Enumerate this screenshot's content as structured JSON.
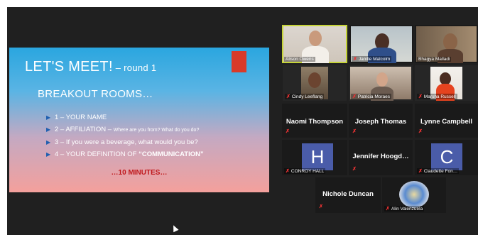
{
  "slide": {
    "title": "LET'S MEET!",
    "title_sub": " – round 1",
    "heading": "BREAKOUT ROOMS…",
    "items": [
      {
        "num": "1 – ",
        "text": "YOUR NAME",
        "small": "",
        "bold": ""
      },
      {
        "num": "2 – ",
        "text": "AFFILIATION – ",
        "small": "Where are you from?  What do you do?",
        "bold": ""
      },
      {
        "num": "3 – ",
        "text": "If you were a beverage, what would you be?",
        "small": "",
        "bold": ""
      },
      {
        "num": "4 – ",
        "text": "YOUR DEFINITION OF ",
        "small": "",
        "bold": "“COMMUNICATION”"
      }
    ],
    "timer": "…10 MINUTES…"
  },
  "participants": [
    {
      "name": "Alison Owens",
      "muted": false,
      "active": true
    },
    {
      "name": "Janille Malcolm",
      "muted": true
    },
    {
      "name": "Bhagya Malladi",
      "muted": false
    },
    {
      "name": "Cindy Leeflang",
      "muted": true
    },
    {
      "name": "Patricia Moraes",
      "muted": true
    },
    {
      "name": "Marsha Russell",
      "muted": true
    },
    {
      "name": "Naomi Thompson",
      "muted": true
    },
    {
      "name": "Joseph Thomas",
      "muted": true
    },
    {
      "name": "Lynne Campbell",
      "muted": true
    },
    {
      "name": "CONROY HALL",
      "initial": "H",
      "muted": true
    },
    {
      "name": "Jennifer  Hoogd…",
      "muted": true
    },
    {
      "name": "Claudette Fon…",
      "initial": "C",
      "muted": true
    },
    {
      "name": "Nichole Duncan",
      "muted": true
    },
    {
      "name": "Alin Valenzuela",
      "muted": true
    }
  ],
  "icons": {
    "mic_muted": "mic-muted-icon"
  },
  "colors": {
    "active_border": "#c6d43a",
    "mic_muted": "#e33333",
    "avatar_bg": "#4a5ca9"
  }
}
